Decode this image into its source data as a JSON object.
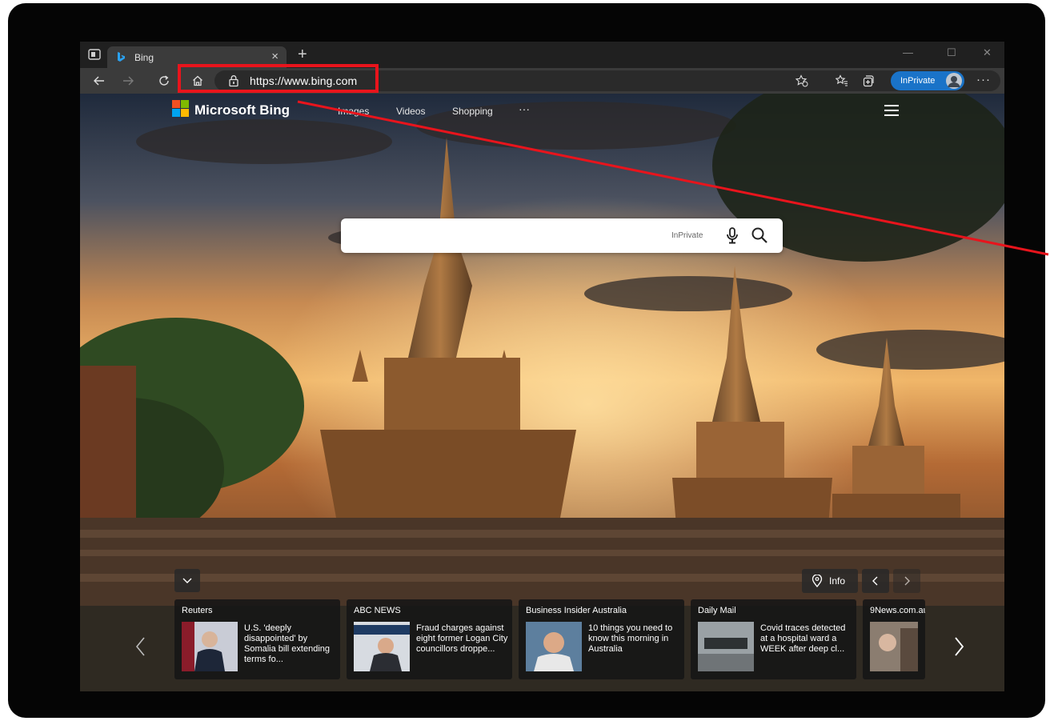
{
  "tab": {
    "title": "Bing",
    "close_glyph": "×",
    "new_tab_glyph": "+"
  },
  "window_controls": {
    "minimize": "—",
    "maximize": "☐",
    "close": "✕"
  },
  "toolbar": {
    "url": "https://www.bing.com",
    "inprivate_label": "InPrivate",
    "more_label": "···"
  },
  "bing": {
    "logo_text": "Microsoft Bing",
    "nav": {
      "images": "Images",
      "videos": "Videos",
      "shopping": "Shopping",
      "more": "···"
    },
    "search": {
      "inprivate_label": "InPrivate",
      "value": ""
    },
    "info_label": "Info"
  },
  "news": [
    {
      "source": "Reuters",
      "headline": "U.S. 'deeply disappointed' by Somalia bill extending terms fo..."
    },
    {
      "source": "ABC NEWS",
      "headline": "Fraud charges against eight former Logan City councillors droppe..."
    },
    {
      "source": "Business Insider Australia",
      "headline": "10 things you need to know this morning in Australia"
    },
    {
      "source": "Daily Mail",
      "headline": "Covid traces detected at a hospital ward a WEEK after deep cl..."
    },
    {
      "source": "9News.com.au",
      "headline": ""
    }
  ],
  "colors": {
    "callout": "#e8141c",
    "inprivate_pill": "#1a73c8",
    "ms_red": "#f25022",
    "ms_green": "#7fba00",
    "ms_blue": "#00a4ef",
    "ms_yellow": "#ffb900"
  },
  "icons": [
    "tab-actions-icon",
    "bing-favicon",
    "back-icon",
    "forward-icon",
    "refresh-icon",
    "home-icon",
    "lock-icon",
    "add-favorite-icon",
    "favorites-icon",
    "collections-icon",
    "microphone-icon",
    "search-icon",
    "chevron-down-icon",
    "location-pin-icon",
    "chevron-left-icon",
    "chevron-right-icon",
    "hamburger-menu-icon"
  ]
}
